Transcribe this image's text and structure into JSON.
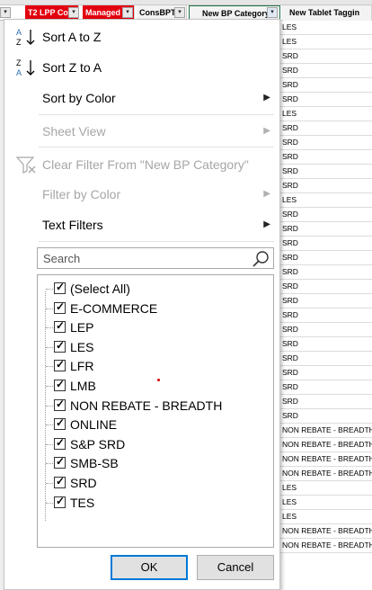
{
  "headers": [
    {
      "label": "T2 LPP Cod",
      "style": "red"
    },
    {
      "label": "Managed",
      "style": "red"
    },
    {
      "label": "ConsBPTy",
      "style": "plain"
    },
    {
      "label": "New BP Category",
      "style": "selected"
    },
    {
      "label": "New Tablet Taggin",
      "style": "plain"
    }
  ],
  "column_l_values": [
    "LES",
    "LES",
    "SRD",
    "SRD",
    "SRD",
    "SRD",
    "LES",
    "SRD",
    "SRD",
    "SRD",
    "SRD",
    "SRD",
    "LES",
    "SRD",
    "SRD",
    "SRD",
    "SRD",
    "SRD",
    "SRD",
    "SRD",
    "SRD",
    "SRD",
    "SRD",
    "SRD",
    "SRD",
    "SRD",
    "SRD",
    "SRD",
    "NON REBATE - BREADTH",
    "NON REBATE - BREADTH",
    "NON REBATE - BREADTH",
    "NON REBATE - BREADTH",
    "LES",
    "LES",
    "LES",
    "NON REBATE - BREADTH",
    "NON REBATE - BREADTH"
  ],
  "menu": {
    "sort_az": "Sort A to Z",
    "sort_za": "Sort Z to A",
    "sort_by_color": "Sort by Color",
    "sheet_view": "Sheet View",
    "clear_filter": "Clear Filter From \"New BP Category\"",
    "filter_by_color": "Filter by Color",
    "text_filters": "Text Filters",
    "search_placeholder": "Search",
    "items": [
      {
        "label": "(Select All)",
        "checked": true
      },
      {
        "label": "E-COMMERCE",
        "checked": true
      },
      {
        "label": "LEP",
        "checked": true
      },
      {
        "label": "LES",
        "checked": true
      },
      {
        "label": "LFR",
        "checked": true
      },
      {
        "label": "LMB",
        "checked": true
      },
      {
        "label": "NON REBATE - BREADTH",
        "checked": true
      },
      {
        "label": "ONLINE",
        "checked": true
      },
      {
        "label": "S&P SRD",
        "checked": true
      },
      {
        "label": "SMB-SB",
        "checked": true
      },
      {
        "label": "SRD",
        "checked": true
      },
      {
        "label": "TES",
        "checked": true
      }
    ],
    "ok_label": "OK",
    "cancel_label": "Cancel"
  },
  "icons": {
    "sort_az": "sort-ascending-icon",
    "sort_za": "sort-descending-icon",
    "clear_filter": "clear-filter-icon",
    "search": "search-icon",
    "submenu": "chevron-right-icon"
  },
  "colors": {
    "red_header": "#e3000f",
    "accent_blue": "#0078d7",
    "disabled_text": "#a6a6a6"
  }
}
